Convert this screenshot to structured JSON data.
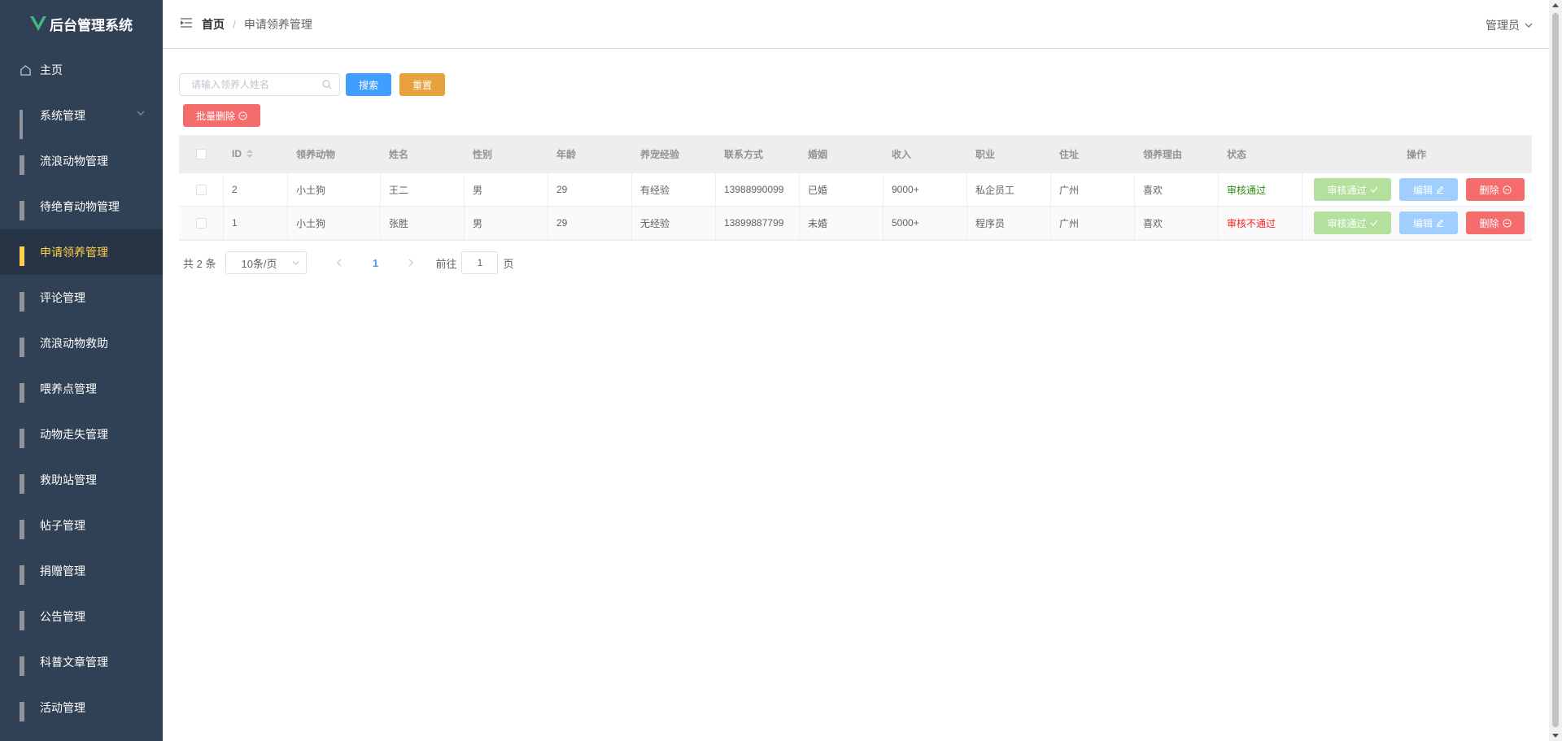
{
  "app": {
    "title": "后台管理系统",
    "logo_icon": "vue-logo-icon",
    "logo_color": "#41b883"
  },
  "sidebar": {
    "background": "#304156",
    "active_color": "#ffd04b",
    "items": [
      {
        "label": "主页",
        "icon": "home-icon"
      },
      {
        "label": "系统管理",
        "icon": "grid-icon",
        "expandable": true
      },
      {
        "label": "流浪动物管理",
        "icon": "menu-icon"
      },
      {
        "label": "待绝育动物管理",
        "icon": "menu-icon"
      },
      {
        "label": "申请领养管理",
        "icon": "menu-icon",
        "active": true
      },
      {
        "label": "评论管理",
        "icon": "menu-icon"
      },
      {
        "label": "流浪动物救助",
        "icon": "menu-icon"
      },
      {
        "label": "喂养点管理",
        "icon": "menu-icon"
      },
      {
        "label": "动物走失管理",
        "icon": "menu-icon"
      },
      {
        "label": "救助站管理",
        "icon": "menu-icon"
      },
      {
        "label": "帖子管理",
        "icon": "menu-icon"
      },
      {
        "label": "捐赠管理",
        "icon": "menu-icon"
      },
      {
        "label": "公告管理",
        "icon": "menu-icon"
      },
      {
        "label": "科普文章管理",
        "icon": "menu-icon"
      },
      {
        "label": "活动管理",
        "icon": "menu-icon"
      }
    ]
  },
  "header": {
    "breadcrumb": {
      "home": "首页",
      "separator": "/",
      "current": "申请领养管理"
    },
    "user": "管理员"
  },
  "toolbar": {
    "search_placeholder": "请输入领养人姓名",
    "search_label": "搜索",
    "reset_label": "重置",
    "batch_delete_label": "批量删除"
  },
  "table": {
    "columns": [
      "ID",
      "领养动物",
      "姓名",
      "性别",
      "年龄",
      "养宠经验",
      "联系方式",
      "婚姻",
      "收入",
      "职业",
      "住址",
      "领养理由",
      "状态",
      "操作"
    ],
    "rows": [
      {
        "id": "2",
        "animal": "小土狗",
        "name": "王二",
        "gender": "男",
        "age": "29",
        "experience": "有经验",
        "phone": "13988990099",
        "marriage": "已婚",
        "income": "9000+",
        "job": "私企员工",
        "address": "广州",
        "reason": "喜欢",
        "status": "审核通过",
        "status_color": "#2e8b0f"
      },
      {
        "id": "1",
        "animal": "小土狗",
        "name": "张胜",
        "gender": "男",
        "age": "29",
        "experience": "无经验",
        "phone": "13899887799",
        "marriage": "未婚",
        "income": "5000+",
        "job": "程序员",
        "address": "广州",
        "reason": "喜欢",
        "status": "审核不通过",
        "status_color": "#ff2020"
      }
    ],
    "actions": {
      "approve": "审核通过",
      "edit": "编辑",
      "delete": "删除"
    }
  },
  "pagination": {
    "total_text": "共 2 条",
    "page_size": "10条/页",
    "current_page": "1",
    "goto_label": "前往",
    "goto_value": "1",
    "page_suffix": "页"
  }
}
